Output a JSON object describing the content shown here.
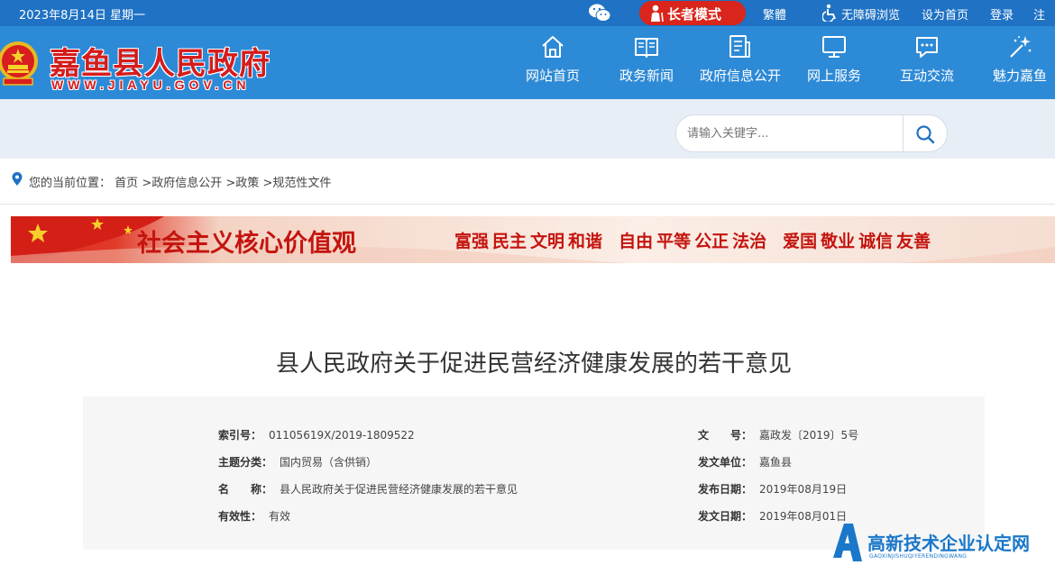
{
  "topbar": {
    "date": "2023年8月14日 星期一",
    "elder_mode": "长者模式",
    "traditional": "繁體",
    "accessibility": "无障碍浏览",
    "set_home": "设为首页",
    "login": "登录",
    "register": "注册"
  },
  "header": {
    "site_name": "嘉鱼县人民政府",
    "site_url": "WWW.JIAYU.GOV.CN",
    "nav": [
      {
        "label": "网站首页",
        "icon": "home-icon"
      },
      {
        "label": "政务新闻",
        "icon": "news-icon"
      },
      {
        "label": "政府信息公开",
        "icon": "info-disclosure-icon"
      },
      {
        "label": "网上服务",
        "icon": "monitor-icon"
      },
      {
        "label": "互动交流",
        "icon": "chat-icon"
      },
      {
        "label": "魅力嘉鱼",
        "icon": "sparkle-icon"
      }
    ]
  },
  "search": {
    "placeholder": "请输入关键字..."
  },
  "breadcrumb": {
    "prefix": "您的当前位置：",
    "items": [
      "首页",
      "政府信息公开",
      "政策",
      "规范性文件"
    ]
  },
  "banner": {
    "headline": "社会主义核心价值观",
    "values": [
      "富强",
      "民主",
      "文明",
      "和谐",
      "自由",
      "平等",
      "公正",
      "法治",
      "爱国",
      "敬业",
      "诚信",
      "友善"
    ]
  },
  "document": {
    "title": "县人民政府关于促进民营经济健康发展的若干意见",
    "meta": {
      "index_label": "索引号：",
      "index_value": "01105619X/2019-1809522",
      "topic_label": "主题分类：",
      "topic_value": "国内贸易（含供销）",
      "name_label": "名　　称：",
      "name_value": "县人民政府关于促进民营经济健康发展的若干意见",
      "validity_label": "有效性：",
      "validity_value": "有效",
      "docno_label": "文　　号：",
      "docno_value": "嘉政发〔2019〕5号",
      "issuer_label": "发文单位：",
      "issuer_value": "嘉鱼县",
      "published_label": "发布日期：",
      "published_value": "2019年08月19日",
      "issued_label": "发文日期：",
      "issued_value": "2019年08月01日"
    }
  },
  "watermark": {
    "title": "高新技术企业认定网",
    "subtitle": "GAOXINJISHUQIYERENDINGWANG"
  },
  "colors": {
    "topbar": "#1f72c4",
    "header": "#2d8ad6",
    "elder_button": "#d9251b",
    "search_band": "#e7eef6",
    "banner_red": "#c4140f"
  }
}
